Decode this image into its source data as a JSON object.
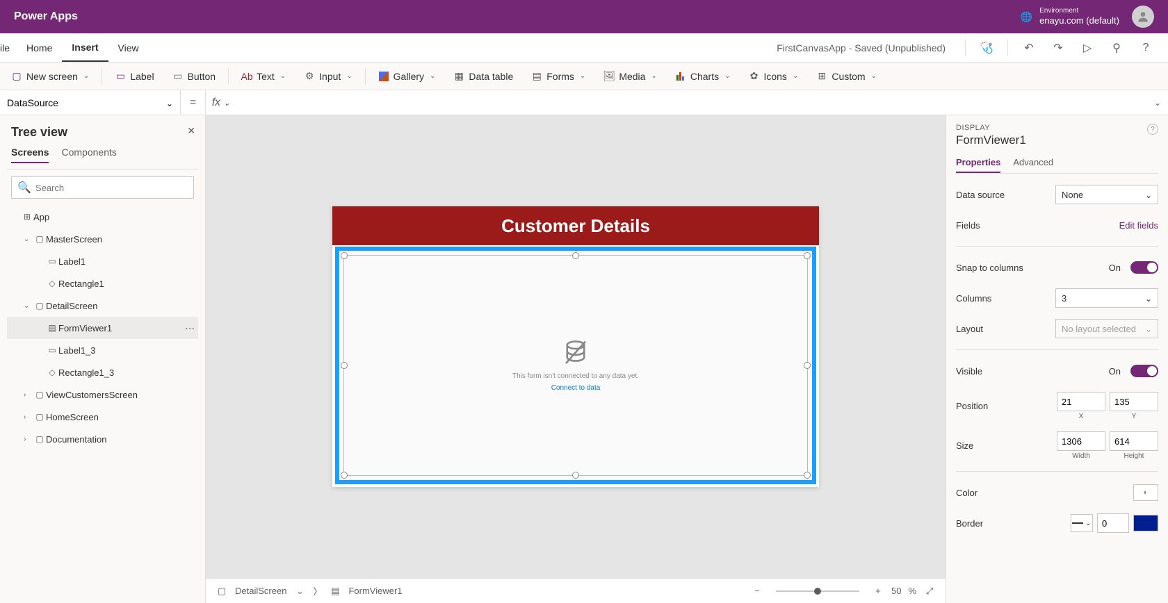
{
  "brand": "Power Apps",
  "environment": {
    "label": "Environment",
    "value": "enayu.com (default)"
  },
  "menu": {
    "file": "ile",
    "home": "Home",
    "insert": "Insert",
    "view": "View"
  },
  "app_status": "FirstCanvasApp - Saved (Unpublished)",
  "ribbon": {
    "new_screen": "New screen",
    "label": "Label",
    "button": "Button",
    "text": "Text",
    "input": "Input",
    "gallery": "Gallery",
    "data_table": "Data table",
    "forms": "Forms",
    "media": "Media",
    "charts": "Charts",
    "icons": "Icons",
    "custom": "Custom"
  },
  "formula": {
    "property": "DataSource",
    "eq": "=",
    "fx": "fx",
    "value": ""
  },
  "tree": {
    "title": "Tree view",
    "tabs": {
      "screens": "Screens",
      "components": "Components"
    },
    "search_placeholder": "Search",
    "app": "App",
    "items": [
      {
        "name": "MasterScreen",
        "children": [
          "Label1",
          "Rectangle1"
        ]
      },
      {
        "name": "DetailScreen",
        "children": [
          "FormViewer1",
          "Label1_3",
          "Rectangle1_3"
        ],
        "selected_child": "FormViewer1"
      },
      {
        "name": "ViewCustomersScreen"
      },
      {
        "name": "HomeScreen"
      },
      {
        "name": "Documentation"
      }
    ]
  },
  "canvas": {
    "header_title": "Customer Details",
    "form_message": "This form isn't connected to any data yet.",
    "form_link": "Connect to data"
  },
  "breadcrumb": {
    "screen": "DetailScreen",
    "element": "FormViewer1",
    "zoom": "50",
    "pct": "%"
  },
  "props": {
    "category": "DISPLAY",
    "name": "FormViewer1",
    "tabs": {
      "properties": "Properties",
      "advanced": "Advanced"
    },
    "data_source": {
      "label": "Data source",
      "value": "None"
    },
    "fields": {
      "label": "Fields",
      "link": "Edit fields"
    },
    "snap": {
      "label": "Snap to columns",
      "state": "On"
    },
    "columns": {
      "label": "Columns",
      "value": "3"
    },
    "layout": {
      "label": "Layout",
      "value": "No layout selected"
    },
    "visible": {
      "label": "Visible",
      "state": "On"
    },
    "position": {
      "label": "Position",
      "x": "21",
      "y": "135",
      "xl": "X",
      "yl": "Y"
    },
    "size": {
      "label": "Size",
      "w": "1306",
      "h": "614",
      "wl": "Width",
      "hl": "Height"
    },
    "color": {
      "label": "Color"
    },
    "border": {
      "label": "Border",
      "width": "0"
    }
  }
}
